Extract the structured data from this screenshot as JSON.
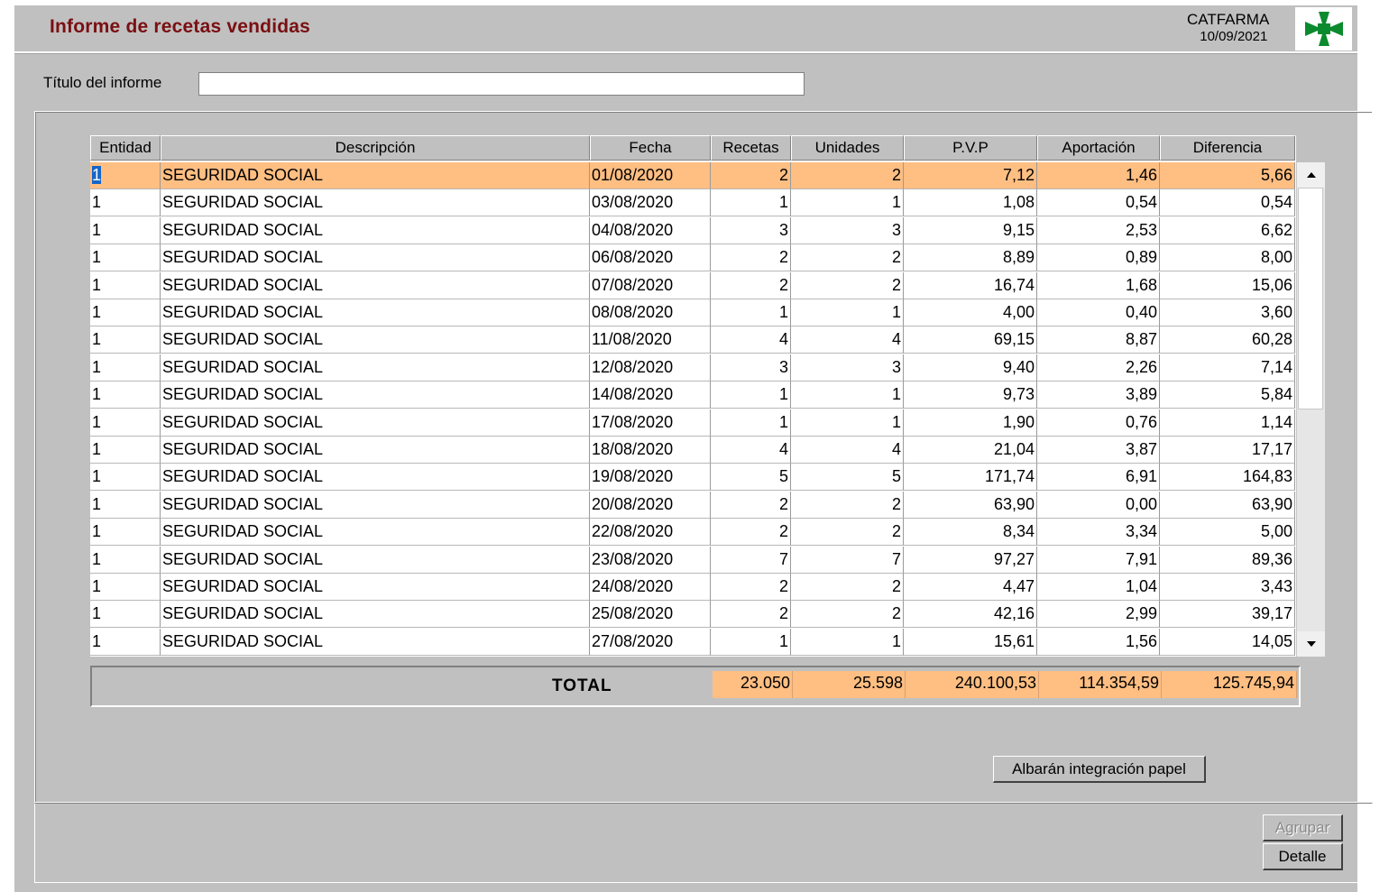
{
  "header": {
    "title": "Informe de recetas vendidas",
    "app_name": "CATFARMA",
    "date": "10/09/2021",
    "logo_color": "#0b8a2e"
  },
  "title_field": {
    "label": "Título del informe",
    "value": ""
  },
  "columns": [
    "Entidad",
    "Descripción",
    "Fecha",
    "Recetas",
    "Unidades",
    "P.V.P",
    "Aportación",
    "Diferencia"
  ],
  "rows": [
    [
      "1",
      "SEGURIDAD SOCIAL",
      "01/08/2020",
      "2",
      "2",
      "7,12",
      "1,46",
      "5,66"
    ],
    [
      "1",
      "SEGURIDAD SOCIAL",
      "03/08/2020",
      "1",
      "1",
      "1,08",
      "0,54",
      "0,54"
    ],
    [
      "1",
      "SEGURIDAD SOCIAL",
      "04/08/2020",
      "3",
      "3",
      "9,15",
      "2,53",
      "6,62"
    ],
    [
      "1",
      "SEGURIDAD SOCIAL",
      "06/08/2020",
      "2",
      "2",
      "8,89",
      "0,89",
      "8,00"
    ],
    [
      "1",
      "SEGURIDAD SOCIAL",
      "07/08/2020",
      "2",
      "2",
      "16,74",
      "1,68",
      "15,06"
    ],
    [
      "1",
      "SEGURIDAD SOCIAL",
      "08/08/2020",
      "1",
      "1",
      "4,00",
      "0,40",
      "3,60"
    ],
    [
      "1",
      "SEGURIDAD SOCIAL",
      "11/08/2020",
      "4",
      "4",
      "69,15",
      "8,87",
      "60,28"
    ],
    [
      "1",
      "SEGURIDAD SOCIAL",
      "12/08/2020",
      "3",
      "3",
      "9,40",
      "2,26",
      "7,14"
    ],
    [
      "1",
      "SEGURIDAD SOCIAL",
      "14/08/2020",
      "1",
      "1",
      "9,73",
      "3,89",
      "5,84"
    ],
    [
      "1",
      "SEGURIDAD SOCIAL",
      "17/08/2020",
      "1",
      "1",
      "1,90",
      "0,76",
      "1,14"
    ],
    [
      "1",
      "SEGURIDAD SOCIAL",
      "18/08/2020",
      "4",
      "4",
      "21,04",
      "3,87",
      "17,17"
    ],
    [
      "1",
      "SEGURIDAD SOCIAL",
      "19/08/2020",
      "5",
      "5",
      "171,74",
      "6,91",
      "164,83"
    ],
    [
      "1",
      "SEGURIDAD SOCIAL",
      "20/08/2020",
      "2",
      "2",
      "63,90",
      "0,00",
      "63,90"
    ],
    [
      "1",
      "SEGURIDAD SOCIAL",
      "22/08/2020",
      "2",
      "2",
      "8,34",
      "3,34",
      "5,00"
    ],
    [
      "1",
      "SEGURIDAD SOCIAL",
      "23/08/2020",
      "7",
      "7",
      "97,27",
      "7,91",
      "89,36"
    ],
    [
      "1",
      "SEGURIDAD SOCIAL",
      "24/08/2020",
      "2",
      "2",
      "4,47",
      "1,04",
      "3,43"
    ],
    [
      "1",
      "SEGURIDAD SOCIAL",
      "25/08/2020",
      "2",
      "2",
      "42,16",
      "2,99",
      "39,17"
    ],
    [
      "1",
      "SEGURIDAD SOCIAL",
      "27/08/2020",
      "1",
      "1",
      "15,61",
      "1,56",
      "14,05"
    ]
  ],
  "selected_row": 0,
  "totals": {
    "label": "TOTAL",
    "recetas": "23.050",
    "unidades": "25.598",
    "pvp": "240.100,53",
    "aportacion": "114.354,59",
    "diferencia": "125.745,94"
  },
  "buttons": {
    "albaran": "Albarán integración papel",
    "agrupar": "Agrupar",
    "detalle": "Detalle"
  },
  "colors": {
    "title": "#7a0f12",
    "highlight": "#ffbe82",
    "window": "#c0c0c0"
  },
  "icons": {
    "scroll_up": "scroll-up-arrow-icon",
    "scroll_down": "scroll-down-arrow-icon"
  }
}
